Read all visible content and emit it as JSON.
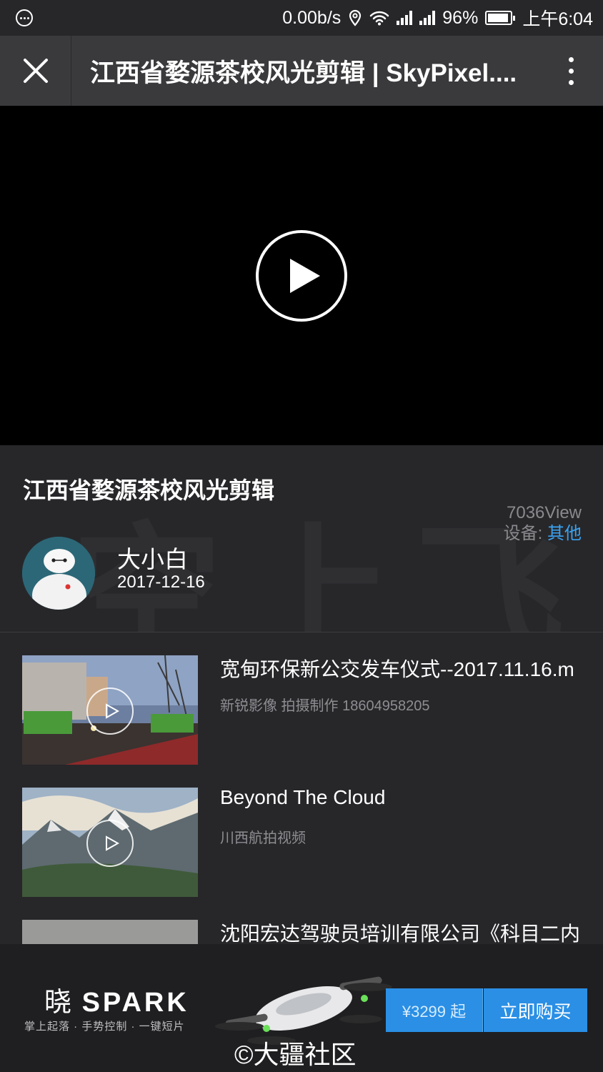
{
  "status_bar": {
    "net_speed": "0.00b/s",
    "battery": "96%",
    "time": "上午6:04"
  },
  "nav": {
    "title": "江西省婺源茶校风光剪辑 | SkyPixel...."
  },
  "video": {
    "title": "江西省婺源茶校风光剪辑",
    "views": "7036View",
    "device_label": "设备: ",
    "device_value": "其他",
    "author": "大小白",
    "date": "2017-12-16",
    "watermark": "空上飞"
  },
  "related": [
    {
      "title": "宽甸环保新公交发车仪式--2017.11.16.m",
      "subtitle": "新锐影像 拍摄制作 18604958205"
    },
    {
      "title": "Beyond The Cloud",
      "subtitle": "川西航拍视频"
    },
    {
      "title": "沈阳宏达驾驶员培训有限公司《科目二内",
      "subtitle": ""
    }
  ],
  "ad": {
    "brand_prefix": "晓",
    "brand_name": "SPARK",
    "tagline": "掌上起落 · 手势控制 · 一键短片",
    "price": "¥3299 起",
    "buy_label": "立即购买",
    "copyright": "©大疆社区"
  },
  "colors": {
    "accent": "#3aa3f2",
    "button": "#2a8fe5",
    "background": "#27272a"
  },
  "icons": [
    "menu-dots-icon",
    "location-icon",
    "wifi-icon",
    "signal-icon",
    "battery-icon",
    "close-icon",
    "more-vertical-icon",
    "play-icon"
  ]
}
